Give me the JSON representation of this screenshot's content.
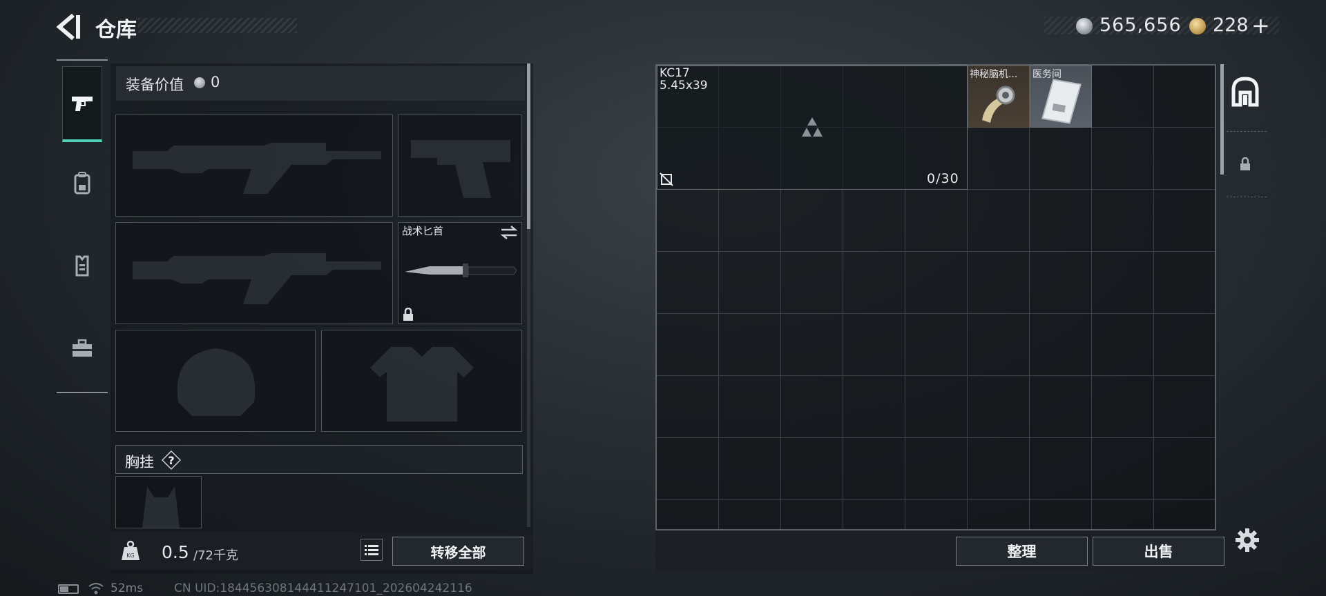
{
  "header": {
    "title": "仓库",
    "silver_amount": "565,656",
    "gold_amount": "228",
    "plus_label": "+"
  },
  "loadout": {
    "equip_value_label": "装备价值",
    "equip_value": "0",
    "melee_name": "战术匕首",
    "chest_rig_label": "胸挂",
    "help_label": "?",
    "weight_current": "0.5",
    "weight_max": "/72千克",
    "transfer_all_label": "转移全部"
  },
  "stash": {
    "magazine_name": "KC17",
    "magazine_caliber": "5.45x39",
    "magazine_count": "0/30",
    "items": [
      {
        "name": "神秘脑机..."
      },
      {
        "name": "医务间"
      }
    ],
    "sort_label": "整理",
    "sell_label": "出售"
  },
  "status": {
    "ping": "52ms",
    "uid": "CN UID:184456308144411247101_202604242116"
  },
  "colors": {
    "accent_tab": "#4fd2b4",
    "panel": "#1b2024",
    "border": "#5a6268"
  },
  "icons": {
    "back": "back-arrow-icon",
    "weapon_tab": "pistol-icon",
    "backpack_tab": "backpack-icon",
    "armor_tab": "vest-icon",
    "case_tab": "toolbox-icon",
    "stash_tab": "stash-icon",
    "settings": "gear-icon"
  }
}
